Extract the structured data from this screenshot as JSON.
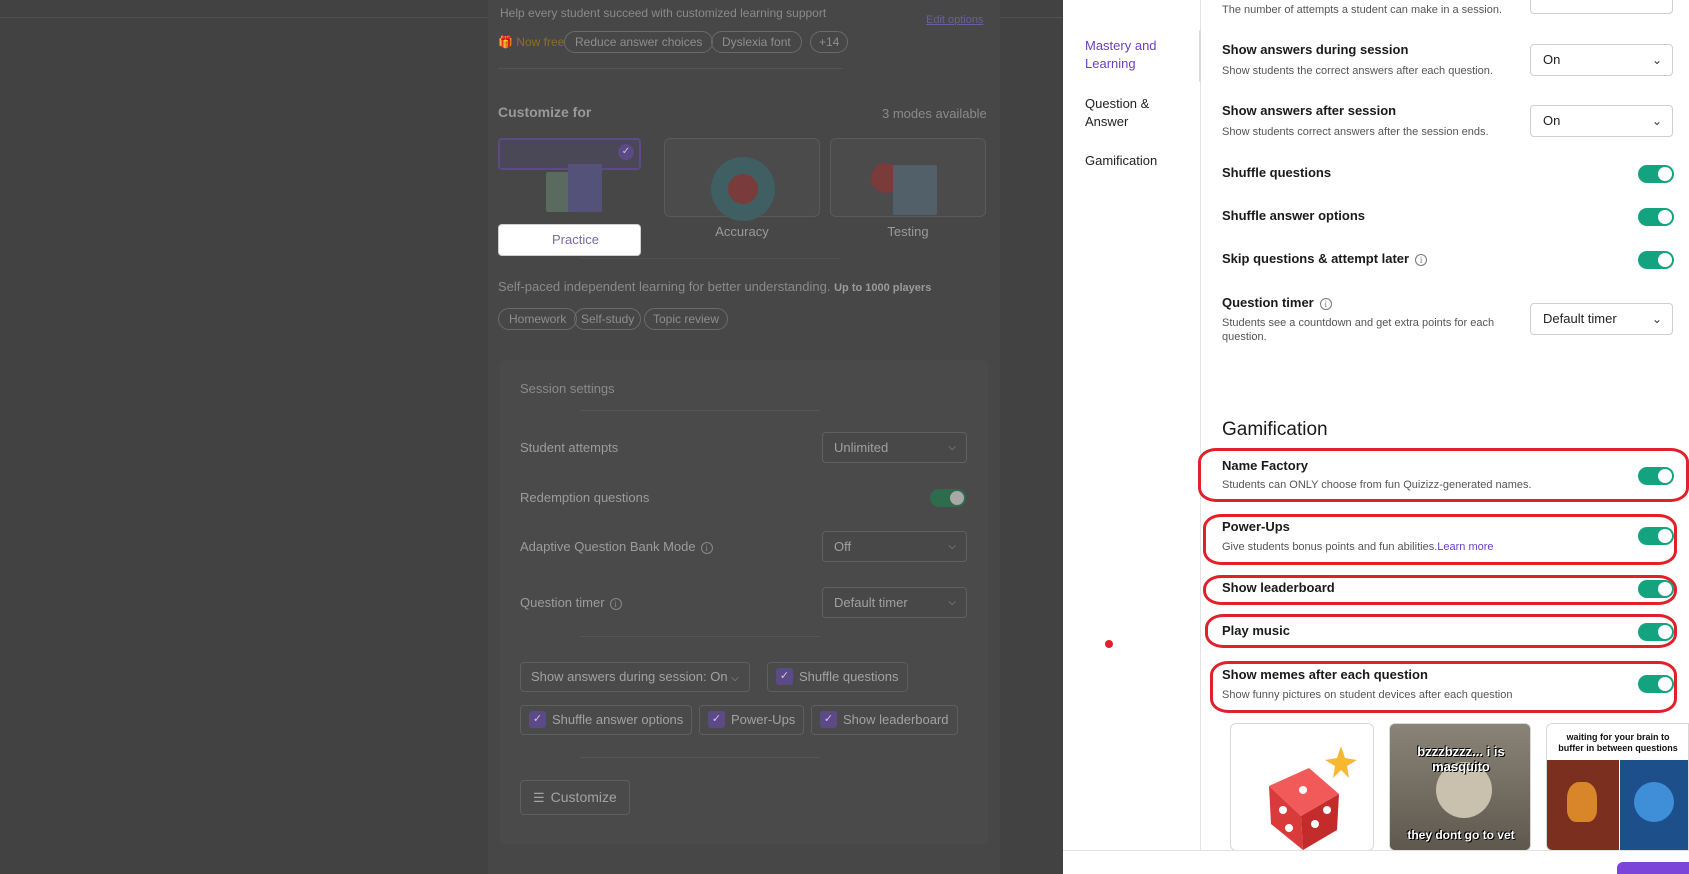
{
  "background": {
    "header_text": "Help every student succeed with customized learning support",
    "edit_options": "Edit options",
    "now_free": "Now free",
    "chips": [
      "Reduce answer choices",
      "Dyslexia font",
      "+14"
    ],
    "customize_for": "Customize for",
    "modes_available": "3 modes available",
    "modes": [
      "Practice",
      "Accuracy",
      "Testing"
    ],
    "mode_description": "Self-paced independent learning for better understanding.",
    "mode_players": "Up to 1000 players",
    "tags": [
      "Homework",
      "Self-study",
      "Topic review"
    ],
    "session_settings": {
      "title": "Session settings",
      "student_attempts_label": "Student attempts",
      "student_attempts_value": "Unlimited",
      "redemption_label": "Redemption questions",
      "adaptive_label": "Adaptive Question Bank Mode",
      "adaptive_value": "Off",
      "timer_label": "Question timer",
      "timer_value": "Default timer"
    },
    "pills": {
      "show_answers": "Show answers during session: On",
      "shuffle_questions": "Shuffle questions",
      "shuffle_answers": "Shuffle answer options",
      "power_ups": "Power-Ups",
      "show_leaderboard": "Show leaderboard"
    },
    "customize_button": "Customize"
  },
  "nav": {
    "items": [
      "Mastery and Learning",
      "Question & Answer",
      "Gamification"
    ],
    "active_index": 0
  },
  "settings": {
    "attempts_desc": "The number of attempts a student can make in a session.",
    "show_answers_during": {
      "title": "Show answers during session",
      "desc": "Show students the correct answers after each question.",
      "value": "On"
    },
    "show_answers_after": {
      "title": "Show answers after session",
      "desc": "Show students correct answers after the session ends.",
      "value": "On"
    },
    "shuffle_questions": {
      "title": "Shuffle questions",
      "on": true
    },
    "shuffle_answer_options": {
      "title": "Shuffle answer options",
      "on": true
    },
    "skip_questions": {
      "title": "Skip questions & attempt later",
      "on": true
    },
    "question_timer": {
      "title": "Question timer",
      "desc": "Students see a countdown and get extra points for each question.",
      "value": "Default timer"
    }
  },
  "gamification": {
    "heading": "Gamification",
    "name_factory": {
      "title": "Name Factory",
      "desc": "Students can ONLY choose from fun Quizizz-generated names.",
      "on": true
    },
    "power_ups": {
      "title": "Power-Ups",
      "desc": "Give students bonus points and fun abilities.",
      "link": "Learn more",
      "on": true
    },
    "show_leaderboard": {
      "title": "Show leaderboard",
      "on": true
    },
    "play_music": {
      "title": "Play music",
      "on": true
    },
    "show_memes": {
      "title": "Show memes after each question",
      "desc": "Show funny pictures on student devices after each question",
      "on": true
    }
  },
  "memes": {
    "meme2_top": "bzzzbzzz... i is masquito",
    "meme2_bottom": "they dont go to vet",
    "meme3_top": "waiting for your brain to buffer in between questions"
  },
  "colors": {
    "accent": "#6b3fbf",
    "toggle_on": "#14a37f",
    "annotation": "#e0202a"
  }
}
